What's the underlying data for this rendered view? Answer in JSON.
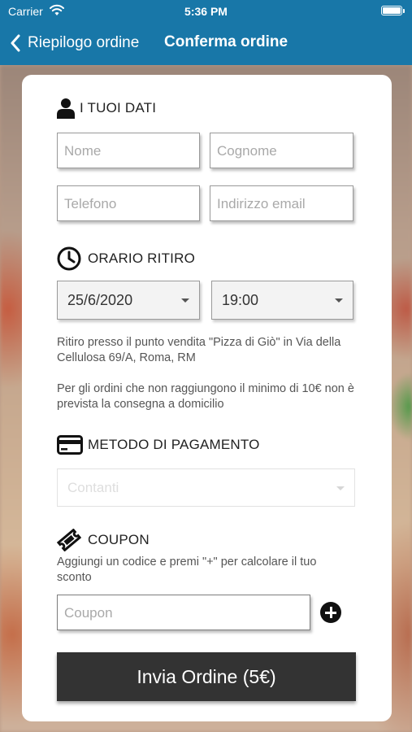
{
  "status_bar": {
    "carrier": "Carrier",
    "time": "5:36 PM"
  },
  "nav": {
    "back_label": "Riepilogo ordine",
    "title": "Conferma ordine"
  },
  "personal": {
    "heading": "I TUOI DATI",
    "name_placeholder": "Nome",
    "surname_placeholder": "Cognome",
    "phone_placeholder": "Telefono",
    "email_placeholder": "Indirizzo email"
  },
  "pickup": {
    "heading": "ORARIO RITIRO",
    "date": "25/6/2020",
    "time": "19:00",
    "info_address": "Ritiro presso il punto vendita \"Pizza di Giò\" in Via della Cellulosa 69/A, Roma, RM",
    "info_minimum": "Per gli ordini che non raggiungono il minimo di 10€ non è prevista la consegna a domicilio"
  },
  "payment": {
    "heading": "METODO DI PAGAMENTO",
    "selected": "Contanti"
  },
  "coupon": {
    "heading": "COUPON",
    "description": "Aggiungi un codice e premi \"+\" per calcolare il tuo sconto",
    "placeholder": "Coupon"
  },
  "submit_label": "Invia Ordine (5€)",
  "colors": {
    "header": "#1877a8",
    "button": "#333333",
    "card": "#ffffff"
  }
}
